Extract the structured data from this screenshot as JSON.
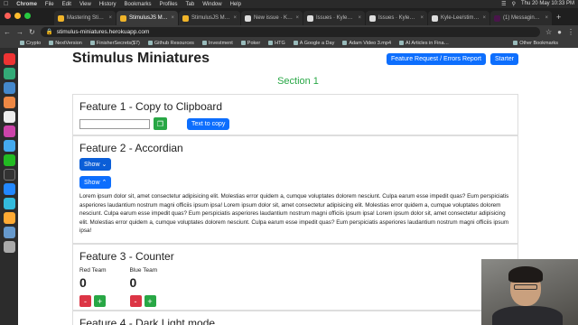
{
  "menubar": {
    "app": "Chrome",
    "items": [
      "File",
      "Edit",
      "View",
      "History",
      "Bookmarks",
      "Profiles",
      "Tab",
      "Window",
      "Help"
    ],
    "clock": "Thu 20 May 10:33 PM"
  },
  "tabs": [
    "Mastering Sti…",
    "StimulusJS M…",
    "StimulusJS M…",
    "New issue · K…",
    "Issues · Kyle…",
    "Issues · Kyle…",
    "Kyle-Lee/stim…",
    "(1) Messagin…"
  ],
  "address": {
    "url": "stimulus-miniatures.herokuapp.com"
  },
  "bookmarks": [
    "Crypto",
    "NextVersion",
    "FinisherSecrets($7)",
    "Github Resources",
    "Investment",
    "Poker",
    "HTG",
    "A Google a Day",
    "Adam Video 3.mp4",
    "AI Articles in Fina…"
  ],
  "bookmarks_other": "Other Bookmarks",
  "page": {
    "title": "Stimulus Miniatures",
    "feature_request_button": "Feature Request / Errors Report",
    "starter_button": "Starter",
    "section": "Section 1",
    "feature1": {
      "title": "Feature 1 - Copy to Clipboard",
      "copy_button": "Text to copy",
      "input_value": ""
    },
    "feature2": {
      "title": "Feature 2 - Accordian",
      "show_button_1": "Show",
      "show_button_2": "Show",
      "text": "Lorem ipsum dolor sit, amet consectetur adipisicing elit. Molestias error quidem a, cumque voluptates dolorem nesciunt. Culpa earum esse impedit quas? Eum perspiciatis asperiores laudantium nostrum magni officiis ipsum ipsa! Lorem ipsum dolor sit, amet consectetur adipisicing elit. Molestias error quidem a, cumque voluptates dolorem nesciunt. Culpa earum esse impedit quas? Eum perspiciatis asperiores laudantium nostrum magni officiis ipsum ipsa! Lorem ipsum dolor sit, amet consectetur adipisicing elit. Molestias error quidem a, cumque voluptates dolorem nesciunt. Culpa earum esse impedit quas? Eum perspiciatis asperiores laudantium nostrum magni officiis ipsum ipsa!"
    },
    "feature3": {
      "title": "Feature 3 - Counter",
      "red": {
        "label": "Red Team",
        "count": "0",
        "minus": "-",
        "plus": "+"
      },
      "blue": {
        "label": "Blue Team",
        "count": "0",
        "minus": "-",
        "plus": "+"
      }
    },
    "feature4": {
      "title": "Feature 4 - Dark Light mode"
    }
  },
  "colors": {
    "primary": "#0d6efd",
    "success": "#28a745",
    "danger": "#dc3545"
  }
}
